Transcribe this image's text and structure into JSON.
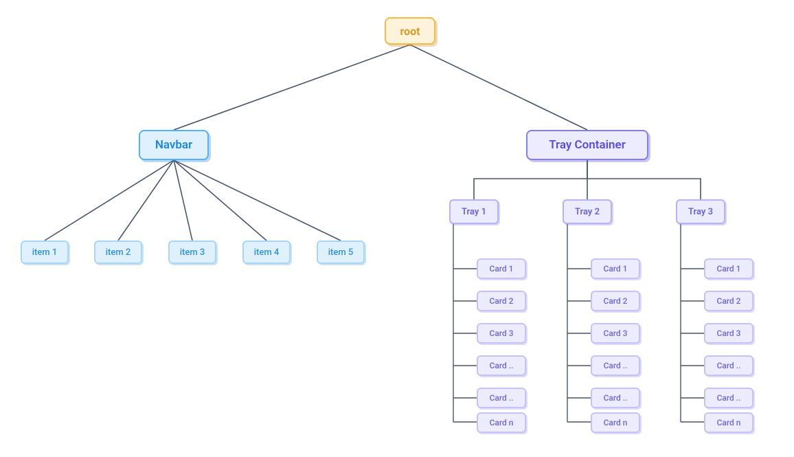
{
  "root": {
    "label": "root"
  },
  "navbar": {
    "label": "Navbar",
    "items": [
      "item 1",
      "item 2",
      "item 3",
      "item 4",
      "item 5"
    ]
  },
  "trayContainer": {
    "label": "Tray Container",
    "trays": [
      {
        "label": "Tray 1",
        "cards": [
          "Card 1",
          "Card 2",
          "Card 3",
          "Card ..",
          "Card ..",
          "Card n"
        ]
      },
      {
        "label": "Tray 2",
        "cards": [
          "Card 1",
          "Card 2",
          "Card 3",
          "Card ..",
          "Card ..",
          "Card n"
        ]
      },
      {
        "label": "Tray 3",
        "cards": [
          "Card 1",
          "Card 2",
          "Card 3",
          "Card ..",
          "Card ..",
          "Card n"
        ]
      }
    ]
  },
  "colors": {
    "root_bg": "#FFF3DB",
    "root_border": "#F5B946",
    "blue_bg": "#DFF1FF",
    "blue_border": "#55B1F7",
    "violet_bg": "#EDECFE",
    "violet_border": "#857CF2",
    "connector": "#4A5568"
  }
}
